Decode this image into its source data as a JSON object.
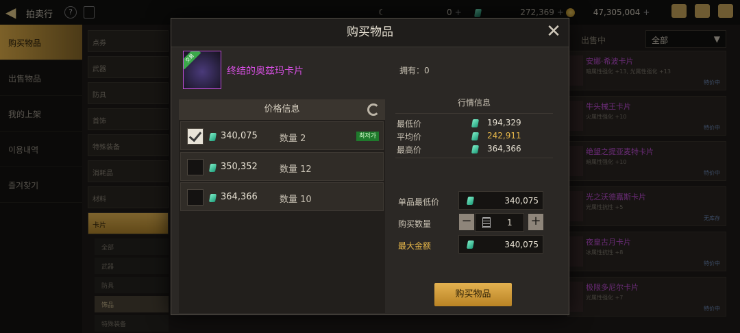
{
  "topbar": {
    "title": "拍卖行",
    "help": "?",
    "gold_a": "0",
    "gems": "272,369",
    "coins": "47,305,004"
  },
  "leftnav": [
    "购买物品",
    "出售物品",
    "我的上架",
    "이용내역",
    "즐겨찾기"
  ],
  "categories": [
    "点券",
    "武器",
    "防具",
    "首饰",
    "特殊装备",
    "消耗品",
    "材料",
    "卡片"
  ],
  "subcategories": [
    "全部",
    "武器",
    "防具",
    "饰品",
    "特殊装备"
  ],
  "rightlist": {
    "header": "出售中",
    "filter": "全部",
    "cards": [
      {
        "name": "安娜·希波卡片",
        "desc": "暗属性强化 +13, 光属性强化 +13",
        "price": "特价中"
      },
      {
        "name": "牛头械王卡片",
        "desc": "火属性强化 +10",
        "price": "特价中"
      },
      {
        "name": "绝望之提亚麦特卡片",
        "desc": "暗属性强化 +10",
        "price": "特价中"
      },
      {
        "name": "光之沃德嘉斯卡片",
        "desc": "光属性抗性 +5",
        "price": "无库存"
      },
      {
        "name": "夜皇古月卡片",
        "desc": "冰属性抗性 +8",
        "price": "特价中"
      },
      {
        "name": "极限多尼尔卡片",
        "desc": "光属性强化 +7",
        "price": "特价中"
      }
    ]
  },
  "modal": {
    "title": "购买物品",
    "close": "✕",
    "item_tag": "交易",
    "item_name": "终结的奥兹玛卡片",
    "owned": "拥有：0",
    "price_info": "价格信息",
    "listings": [
      {
        "price": "340,075",
        "qty": "数量 2",
        "low": "최저가",
        "checked": true
      },
      {
        "price": "350,352",
        "qty": "数量 12",
        "checked": false
      },
      {
        "price": "364,366",
        "qty": "数量 10",
        "checked": false
      }
    ],
    "market_title": "行情信息",
    "market": [
      {
        "label": "最低价",
        "value": "194,329"
      },
      {
        "label": "平均价",
        "value": "242,911"
      },
      {
        "label": "最高价",
        "value": "364,366"
      }
    ],
    "unit_low_label": "单品最低价",
    "unit_low_value": "340,075",
    "qty_label": "购买数量",
    "qty_value": "1",
    "minus": "−",
    "plus": "+",
    "max_label": "最大金额",
    "max_value": "340,075",
    "buy": "购买物品"
  },
  "colors": {
    "accent": "#e3b150",
    "item_name": "#d44fe0",
    "avg": "#e8b84a"
  }
}
